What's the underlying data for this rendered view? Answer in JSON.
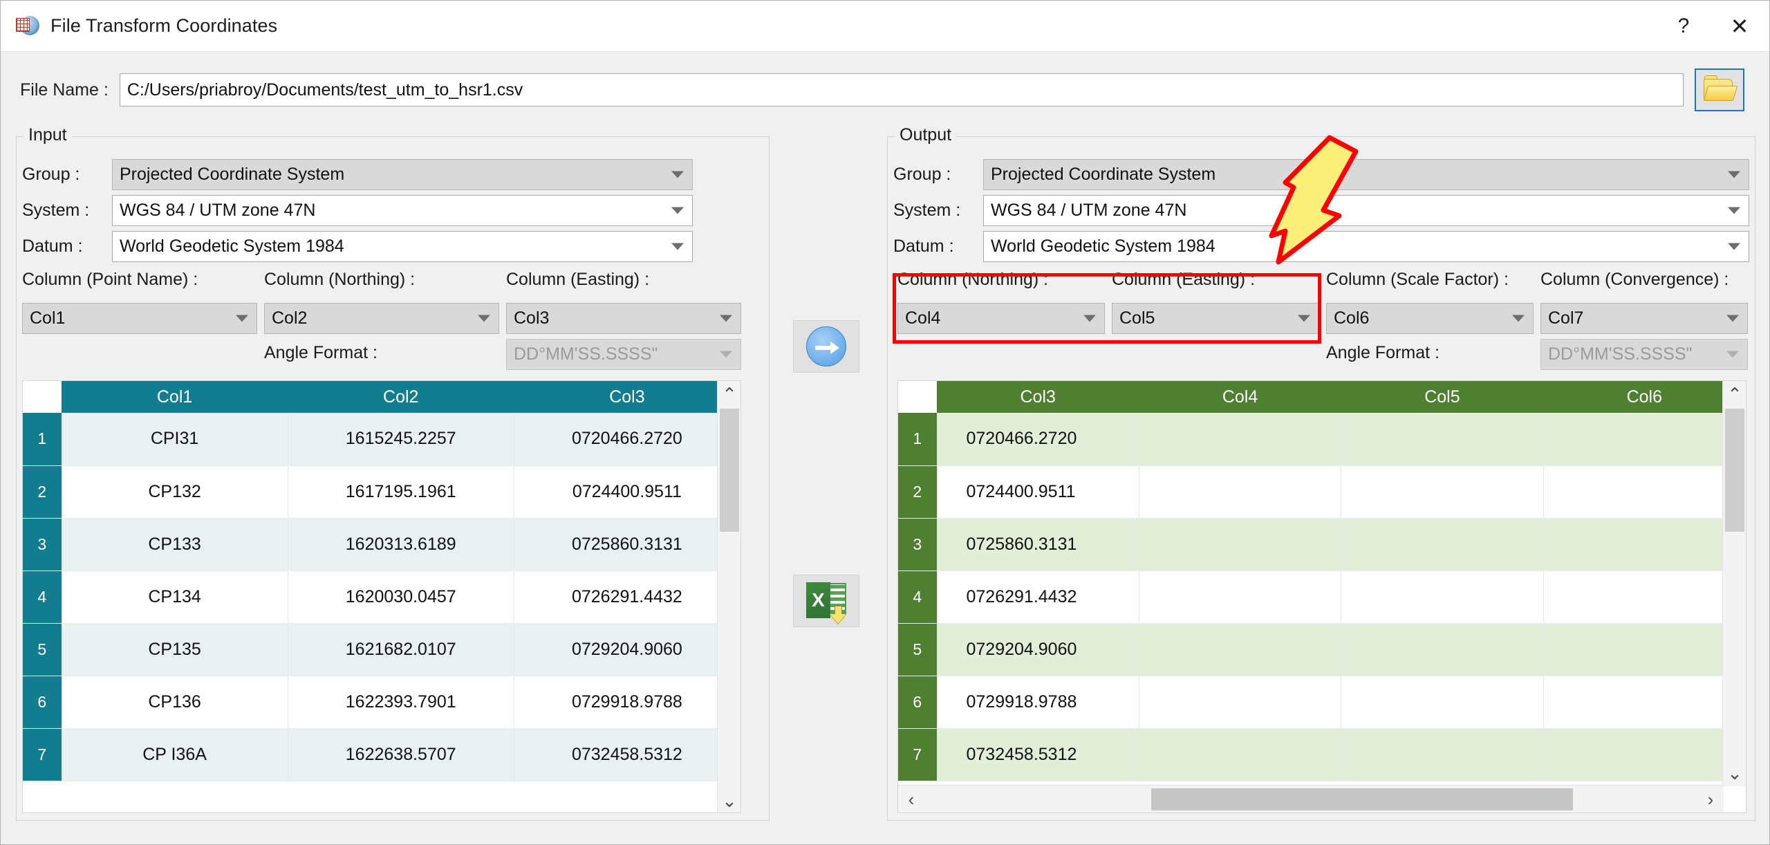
{
  "window": {
    "title": "File Transform Coordinates",
    "app_icon": "globe-grid-icon",
    "help_label": "?",
    "close_label": "✕"
  },
  "file": {
    "label": "File Name :",
    "value": "C:/Users/priabroy/Documents/test_utm_to_hsr1.csv",
    "browse_icon": "folder-open-icon"
  },
  "input": {
    "legend": "Input",
    "group": {
      "label": "Group :",
      "value": "Projected Coordinate System"
    },
    "system": {
      "label": "System :",
      "value": "WGS 84 / UTM zone 47N"
    },
    "datum": {
      "label": "Datum :",
      "value": "World Geodetic System 1984"
    },
    "columns": [
      {
        "label": "Column (Point Name) :",
        "value": "Col1"
      },
      {
        "label": "Column (Northing) :",
        "value": "Col2"
      },
      {
        "label": "Column (Easting) :",
        "value": "Col3"
      }
    ],
    "angle_format": {
      "label": "Angle Format :",
      "value": "DD°MM'SS.SSSS\""
    },
    "table": {
      "header_color": "#137d90",
      "corner": "",
      "headers": [
        "Col1",
        "Col2",
        "Col3"
      ],
      "rows": [
        {
          "n": "1",
          "cells": [
            "CPI31",
            "1615245.2257",
            "0720466.2720"
          ]
        },
        {
          "n": "2",
          "cells": [
            "CP132",
            "1617195.1961",
            "0724400.9511"
          ]
        },
        {
          "n": "3",
          "cells": [
            "CP133",
            "1620313.6189",
            "0725860.3131"
          ]
        },
        {
          "n": "4",
          "cells": [
            "CP134",
            "1620030.0457",
            "0726291.4432"
          ]
        },
        {
          "n": "5",
          "cells": [
            "CP135",
            "1621682.0107",
            "0729204.9060"
          ]
        },
        {
          "n": "6",
          "cells": [
            "CP136",
            "1622393.7901",
            "0729918.9788"
          ]
        },
        {
          "n": "7",
          "cells": [
            "CP I36A",
            "1622638.5707",
            "0732458.5312"
          ]
        }
      ]
    }
  },
  "output": {
    "legend": "Output",
    "group": {
      "label": "Group :",
      "value": "Projected Coordinate System"
    },
    "system": {
      "label": "System :",
      "value": "WGS 84 / UTM zone 47N"
    },
    "datum": {
      "label": "Datum :",
      "value": "World Geodetic System 1984"
    },
    "columns": [
      {
        "label": "Column (Northing) :",
        "value": "Col4"
      },
      {
        "label": "Column (Easting) :",
        "value": "Col5"
      },
      {
        "label": "Column (Scale Factor) :",
        "value": "Col6"
      },
      {
        "label": "Column (Convergence) :",
        "value": "Col7"
      }
    ],
    "angle_format": {
      "label": "Angle Format :",
      "value": "DD°MM'SS.SSSS\""
    },
    "table": {
      "header_color": "#4f8031",
      "corner": "",
      "headers": [
        "Col3",
        "Col4",
        "Col5",
        "Col6"
      ],
      "rows": [
        {
          "n": "1",
          "cells": [
            "0720466.2720",
            "",
            "",
            ""
          ]
        },
        {
          "n": "2",
          "cells": [
            "0724400.9511",
            "",
            "",
            ""
          ]
        },
        {
          "n": "3",
          "cells": [
            "0725860.3131",
            "",
            "",
            ""
          ]
        },
        {
          "n": "4",
          "cells": [
            "0726291.4432",
            "",
            "",
            ""
          ]
        },
        {
          "n": "5",
          "cells": [
            "0729204.9060",
            "",
            "",
            ""
          ]
        },
        {
          "n": "6",
          "cells": [
            "0729918.9788",
            "",
            "",
            ""
          ]
        },
        {
          "n": "7",
          "cells": [
            "0732458.5312",
            "",
            "",
            ""
          ]
        }
      ]
    }
  },
  "middle": {
    "transform_icon": "blue-right-arrow-icon",
    "export_icon": "excel-export-icon"
  },
  "scrollbars": {
    "up_glyph": "⌃",
    "down_glyph": "⌄",
    "left_glyph": "‹",
    "right_glyph": "›"
  },
  "annotations": {
    "highlight_color": "#ff0000",
    "arrow_fill": "#fdf07a",
    "arrow_stroke": "#ff0000"
  }
}
